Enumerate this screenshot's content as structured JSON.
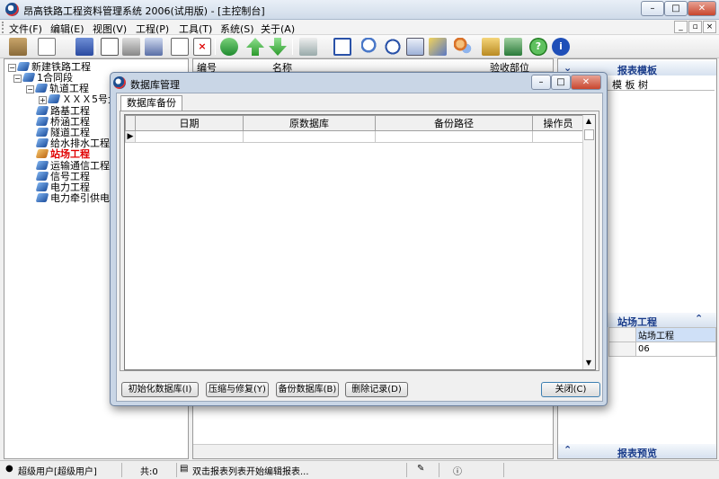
{
  "window": {
    "title": "昂高铁路工程资料管理系统 2006(试用版) - [主控制台]",
    "minimize": "–",
    "maximize": "□",
    "close": "✕"
  },
  "menu": [
    "文件(F)",
    "编辑(E)",
    "视图(V)",
    "工程(P)",
    "工具(T)",
    "系统(S)",
    "关于(A)"
  ],
  "toolbar": [
    "folder-open-icon",
    "new-doc-icon",
    "save-icon",
    "search-doc-icon",
    "print-icon",
    "print-preview-icon",
    "copy-icon",
    "delete-icon",
    "refresh-icon",
    "up-arrow-icon",
    "down-arrow-icon",
    "edit-icon",
    "comment-icon",
    "find-icon",
    "clock-icon",
    "calculator-icon",
    "tools-icon",
    "users-icon",
    "export-icon",
    "download-icon",
    "help-icon",
    "info-icon"
  ],
  "tree": {
    "root": "新建铁路工程",
    "child1": "1合同段",
    "child2": "轨道工程",
    "child3": "ＸＸＸ5号大",
    "items": [
      "路基工程",
      "桥涵工程",
      "隧道工程",
      "给水排水工程",
      "站场工程",
      "运输通信工程",
      "信号工程",
      "电力工程",
      "电力牵引供电工"
    ]
  },
  "center": {
    "columns": [
      "编号",
      "名称",
      "验收部位"
    ]
  },
  "right": {
    "header1": "报表模板",
    "tabs": "模 板 树",
    "header2": "站场工程",
    "cell1": "站场工程",
    "cell2": "06",
    "footer": "报表预览"
  },
  "status": {
    "user": "超级用户[超级用户]",
    "count": "共:0",
    "hint": "双击报表列表开始编辑报表..."
  },
  "dialog": {
    "title": "数据库管理",
    "tab": "数据库备份",
    "columns": [
      "日期",
      "原数据库",
      "备份路径",
      "操作员"
    ],
    "buttons": {
      "init": "初始化数据库(I)",
      "compress": "压缩与修复(Y)",
      "backup": "备份数据库(B)",
      "delete": "删除记录(D)",
      "close": "关闭(C)"
    }
  }
}
